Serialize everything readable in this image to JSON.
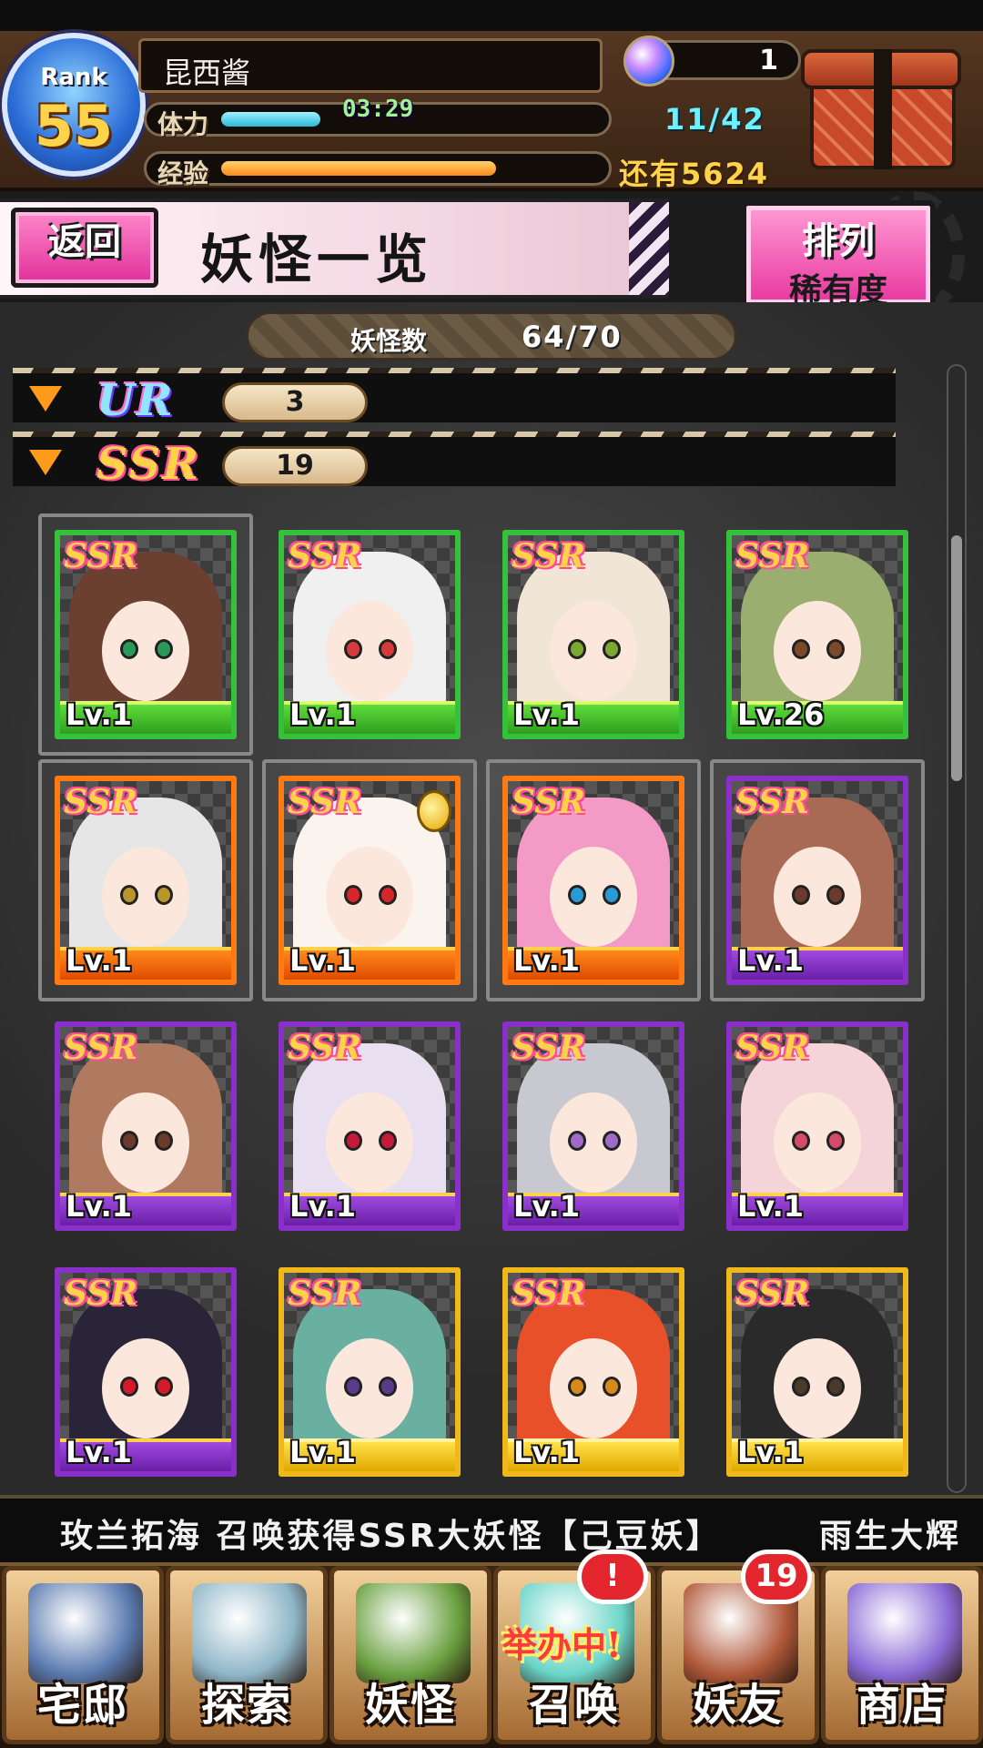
{
  "player": {
    "rank_label": "Rank",
    "rank_value": "55",
    "name": "昆西酱",
    "orb_count": "1",
    "stamina_label": "体力",
    "stamina_timer": "03:29",
    "stamina_value": "11/42",
    "stamina_fraction": 0.26,
    "exp_label": "经验",
    "exp_remaining": "还有5624",
    "exp_fraction": 0.72
  },
  "header": {
    "back_label": "返回",
    "title": "妖怪一览",
    "sort_label": "排列",
    "sort_value": "稀有度"
  },
  "summary": {
    "count_label": "妖怪数",
    "count_value": "64/70"
  },
  "rarity_groups": [
    {
      "name": "UR",
      "count": "3"
    },
    {
      "name": "SSR",
      "count": "19"
    }
  ],
  "cards": [
    {
      "rarity": "SSR",
      "level": "Lv.1",
      "frame": "green",
      "hair": "#6b4030",
      "eyes": "#2a9a58",
      "selected": true
    },
    {
      "rarity": "SSR",
      "level": "Lv.1",
      "frame": "green",
      "hair": "#f0f0f0",
      "eyes": "#d63a3a",
      "selected": false
    },
    {
      "rarity": "SSR",
      "level": "Lv.1",
      "frame": "green",
      "hair": "#f1e6d6",
      "eyes": "#7aa830",
      "selected": false
    },
    {
      "rarity": "SSR",
      "level": "Lv.26",
      "frame": "green",
      "hair": "#9aae70",
      "eyes": "#7a4a2a",
      "selected": false
    },
    {
      "rarity": "SSR",
      "level": "Lv.1",
      "frame": "orange",
      "hair": "#e6e6e6",
      "eyes": "#b8962a",
      "selected": true
    },
    {
      "rarity": "SSR",
      "level": "Lv.1",
      "frame": "orange",
      "hair": "#fbf4ee",
      "eyes": "#d6262a",
      "selected": true,
      "crown": true
    },
    {
      "rarity": "SSR",
      "level": "Lv.1",
      "frame": "orange",
      "hair": "#f49ac6",
      "eyes": "#2a9ad6",
      "selected": true
    },
    {
      "rarity": "SSR",
      "level": "Lv.1",
      "frame": "purple",
      "hair": "#a86a54",
      "eyes": "#6a3a2a",
      "selected": true
    },
    {
      "rarity": "SSR",
      "level": "Lv.1",
      "frame": "purple",
      "hair": "#b07a60",
      "eyes": "#6a3a2a",
      "selected": false
    },
    {
      "rarity": "SSR",
      "level": "Lv.1",
      "frame": "purple",
      "hair": "#e8e0f0",
      "eyes": "#c61a3a",
      "selected": false
    },
    {
      "rarity": "SSR",
      "level": "Lv.1",
      "frame": "purple",
      "hair": "#c8c8d0",
      "eyes": "#a06ac8",
      "selected": false
    },
    {
      "rarity": "SSR",
      "level": "Lv.1",
      "frame": "purple",
      "hair": "#f4d4d8",
      "eyes": "#d64a6a",
      "selected": false
    },
    {
      "rarity": "SSR",
      "level": "Lv.1",
      "frame": "purple",
      "hair": "#2a2438",
      "eyes": "#d61a2a",
      "selected": false
    },
    {
      "rarity": "SSR",
      "level": "Lv.1",
      "frame": "gold",
      "hair": "#6ab0a0",
      "eyes": "#5a3a8a",
      "selected": false
    },
    {
      "rarity": "SSR",
      "level": "Lv.1",
      "frame": "gold",
      "hair": "#e8502a",
      "eyes": "#d68a1a",
      "selected": false
    },
    {
      "rarity": "SSR",
      "level": "Lv.1",
      "frame": "gold",
      "hair": "#2a2a2a",
      "eyes": "#4a3a2a",
      "selected": false
    }
  ],
  "ticker": {
    "message": "玫兰拓海 召唤获得SSR大妖怪【己豆妖】",
    "message_next": "雨生大辉"
  },
  "nav": {
    "items": [
      {
        "label": "宅邸",
        "icon": "house-icon",
        "color": "#5a7ab0"
      },
      {
        "label": "探索",
        "icon": "magnifier-icon",
        "color": "#8fb6c8"
      },
      {
        "label": "妖怪",
        "icon": "scroll-icon",
        "color": "#6aa040"
      },
      {
        "label": "召唤",
        "icon": "star-icon",
        "color": "#6ad6c8"
      },
      {
        "label": "妖友",
        "icon": "friend-avatar-icon",
        "color": "#b0583a"
      },
      {
        "label": "商店",
        "icon": "orb-icon",
        "color": "#8a6ad6"
      }
    ],
    "summon_event": "举办中!",
    "summon_badge": "!",
    "friend_badge": "19"
  }
}
